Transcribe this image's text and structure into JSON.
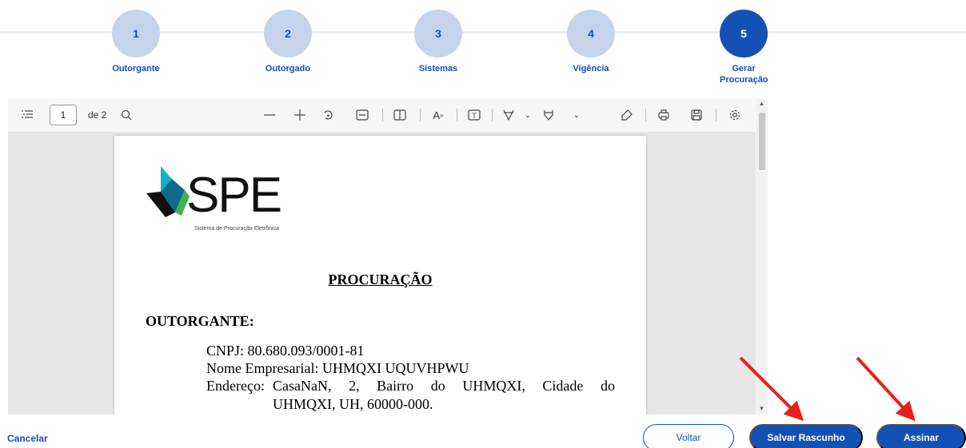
{
  "stepper": {
    "steps": [
      {
        "number": "1",
        "label": "Outorgante"
      },
      {
        "number": "2",
        "label": "Outorgado"
      },
      {
        "number": "3",
        "label": "Sistemas"
      },
      {
        "number": "4",
        "label": "Vigência"
      },
      {
        "number": "5",
        "label": "Gerar Procuração"
      }
    ],
    "active_step": 5
  },
  "viewer": {
    "current_page": "1",
    "page_count_label": "de 2",
    "toolbar_icons": [
      "contents-icon",
      "search-icon",
      "zoom-out-icon",
      "zoom-in-icon",
      "rotate-icon",
      "fit-width-icon",
      "page-view-icon",
      "read-aloud-icon",
      "text-box-icon",
      "draw-icon",
      "highlight-icon",
      "eraser-icon",
      "print-icon",
      "save-icon",
      "settings-icon"
    ]
  },
  "document": {
    "logo_text": "SPE",
    "logo_subtitle": "Sistema de Procuração Eletrônica",
    "title": "PROCURAÇÃO",
    "section_outorgante": "OUTORGANTE:",
    "cnpj_line": "CNPJ: 80.680.093/0001-81",
    "nome_line": "Nome Empresarial: UHMQXI UQUVHPWU",
    "endereco_label": "Endereço:",
    "endereco_line1": "CasaNaN, 2, Bairro do UHMQXI, Cidade do",
    "endereco_line2": "UHMQXI, UH, 60000-000."
  },
  "actions": {
    "cancel": "Cancelar",
    "back": "Voltar",
    "save_draft": "Salvar Rascunho",
    "sign": "Assinar"
  },
  "colors": {
    "primary": "#1351b4",
    "step_inactive": "#c5d4eb",
    "annotation_arrow": "#e8201c"
  }
}
